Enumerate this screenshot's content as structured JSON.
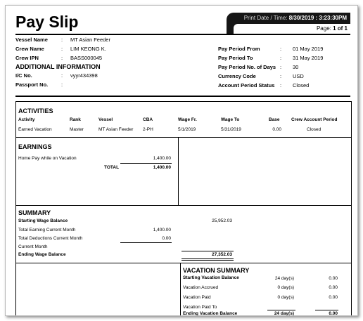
{
  "header": {
    "title": "Pay Slip",
    "print_label": "Print Date / Time:",
    "print_value": "8/30/2019 : 3:23:30PM",
    "page_label": "Page:",
    "page_value": "1 of 1"
  },
  "vessel_info": [
    {
      "label": "Vessel Name",
      "value": "MT Asian Feeder"
    },
    {
      "label": "Crew Name",
      "value": "LIM KEONG K."
    },
    {
      "label": "Crew IPN",
      "value": "BASS000045"
    }
  ],
  "additional": {
    "heading": "ADDITIONAL INFORMATION",
    "items": [
      {
        "label": "I/C No.",
        "value": "vyyr434398"
      },
      {
        "label": "Passport No.",
        "value": ""
      }
    ]
  },
  "separator": ":",
  "pay_period": [
    {
      "label": "Pay Period From",
      "value": "01 May 2019"
    },
    {
      "label": "Pay Period To",
      "value": "31 May 2019"
    },
    {
      "label": "Pay Period No. of Days",
      "value": "30"
    },
    {
      "label": "Currency Code",
      "value": "USD"
    },
    {
      "label": "Account Period Status",
      "value": "Closed"
    }
  ],
  "activities": {
    "heading": "ACTIVITIES",
    "columns": [
      "Activity",
      "Rank",
      "Vessel",
      "CBA",
      "Wage Fr.",
      "Wage To",
      "Base",
      "Crew Account Period"
    ],
    "rows": [
      [
        "Earned Vacation",
        "Master",
        "MT Asian Feeder",
        "2-PH",
        "5/1/2019",
        "5/31/2019",
        "0.00",
        "Closed"
      ]
    ]
  },
  "earnings": {
    "heading": "EARNINGS",
    "item_label": "Home Pay while on Vacation",
    "item_value": "1,400.00",
    "total_label": "TOTAL",
    "total_value": "1,400.00"
  },
  "summary": {
    "heading": "SUMMARY",
    "starting_label": "Starting Wage Balance",
    "starting_value": "25,952.03",
    "earning_label": "Total Earning Current Month",
    "earning_value": "1,400.00",
    "deductions_label": "Total Deductions Current Month",
    "deductions_value": "0.00",
    "current_label": "Current Month",
    "ending_label": "Ending Wage Balance",
    "ending_value": "27,352.03"
  },
  "vacation": {
    "heading": "VACATION SUMMARY",
    "rows": [
      {
        "label": "Starting Vacation Balance",
        "days": "24 day(s)",
        "amount": "0.00",
        "bold": true
      },
      {
        "label": "Vacation Accrued",
        "days": "0 day(s)",
        "amount": "0.00",
        "bold": false
      },
      {
        "label": "Vacation Paid",
        "days": "0 day(s)",
        "amount": "0.00",
        "bold": false
      },
      {
        "label": "Vacation Paid To",
        "days": "",
        "amount": "",
        "bold": false
      },
      {
        "label": "Ending Vacation Balance",
        "days": "24 day(s)",
        "amount": "0.00",
        "bold": true
      }
    ]
  }
}
